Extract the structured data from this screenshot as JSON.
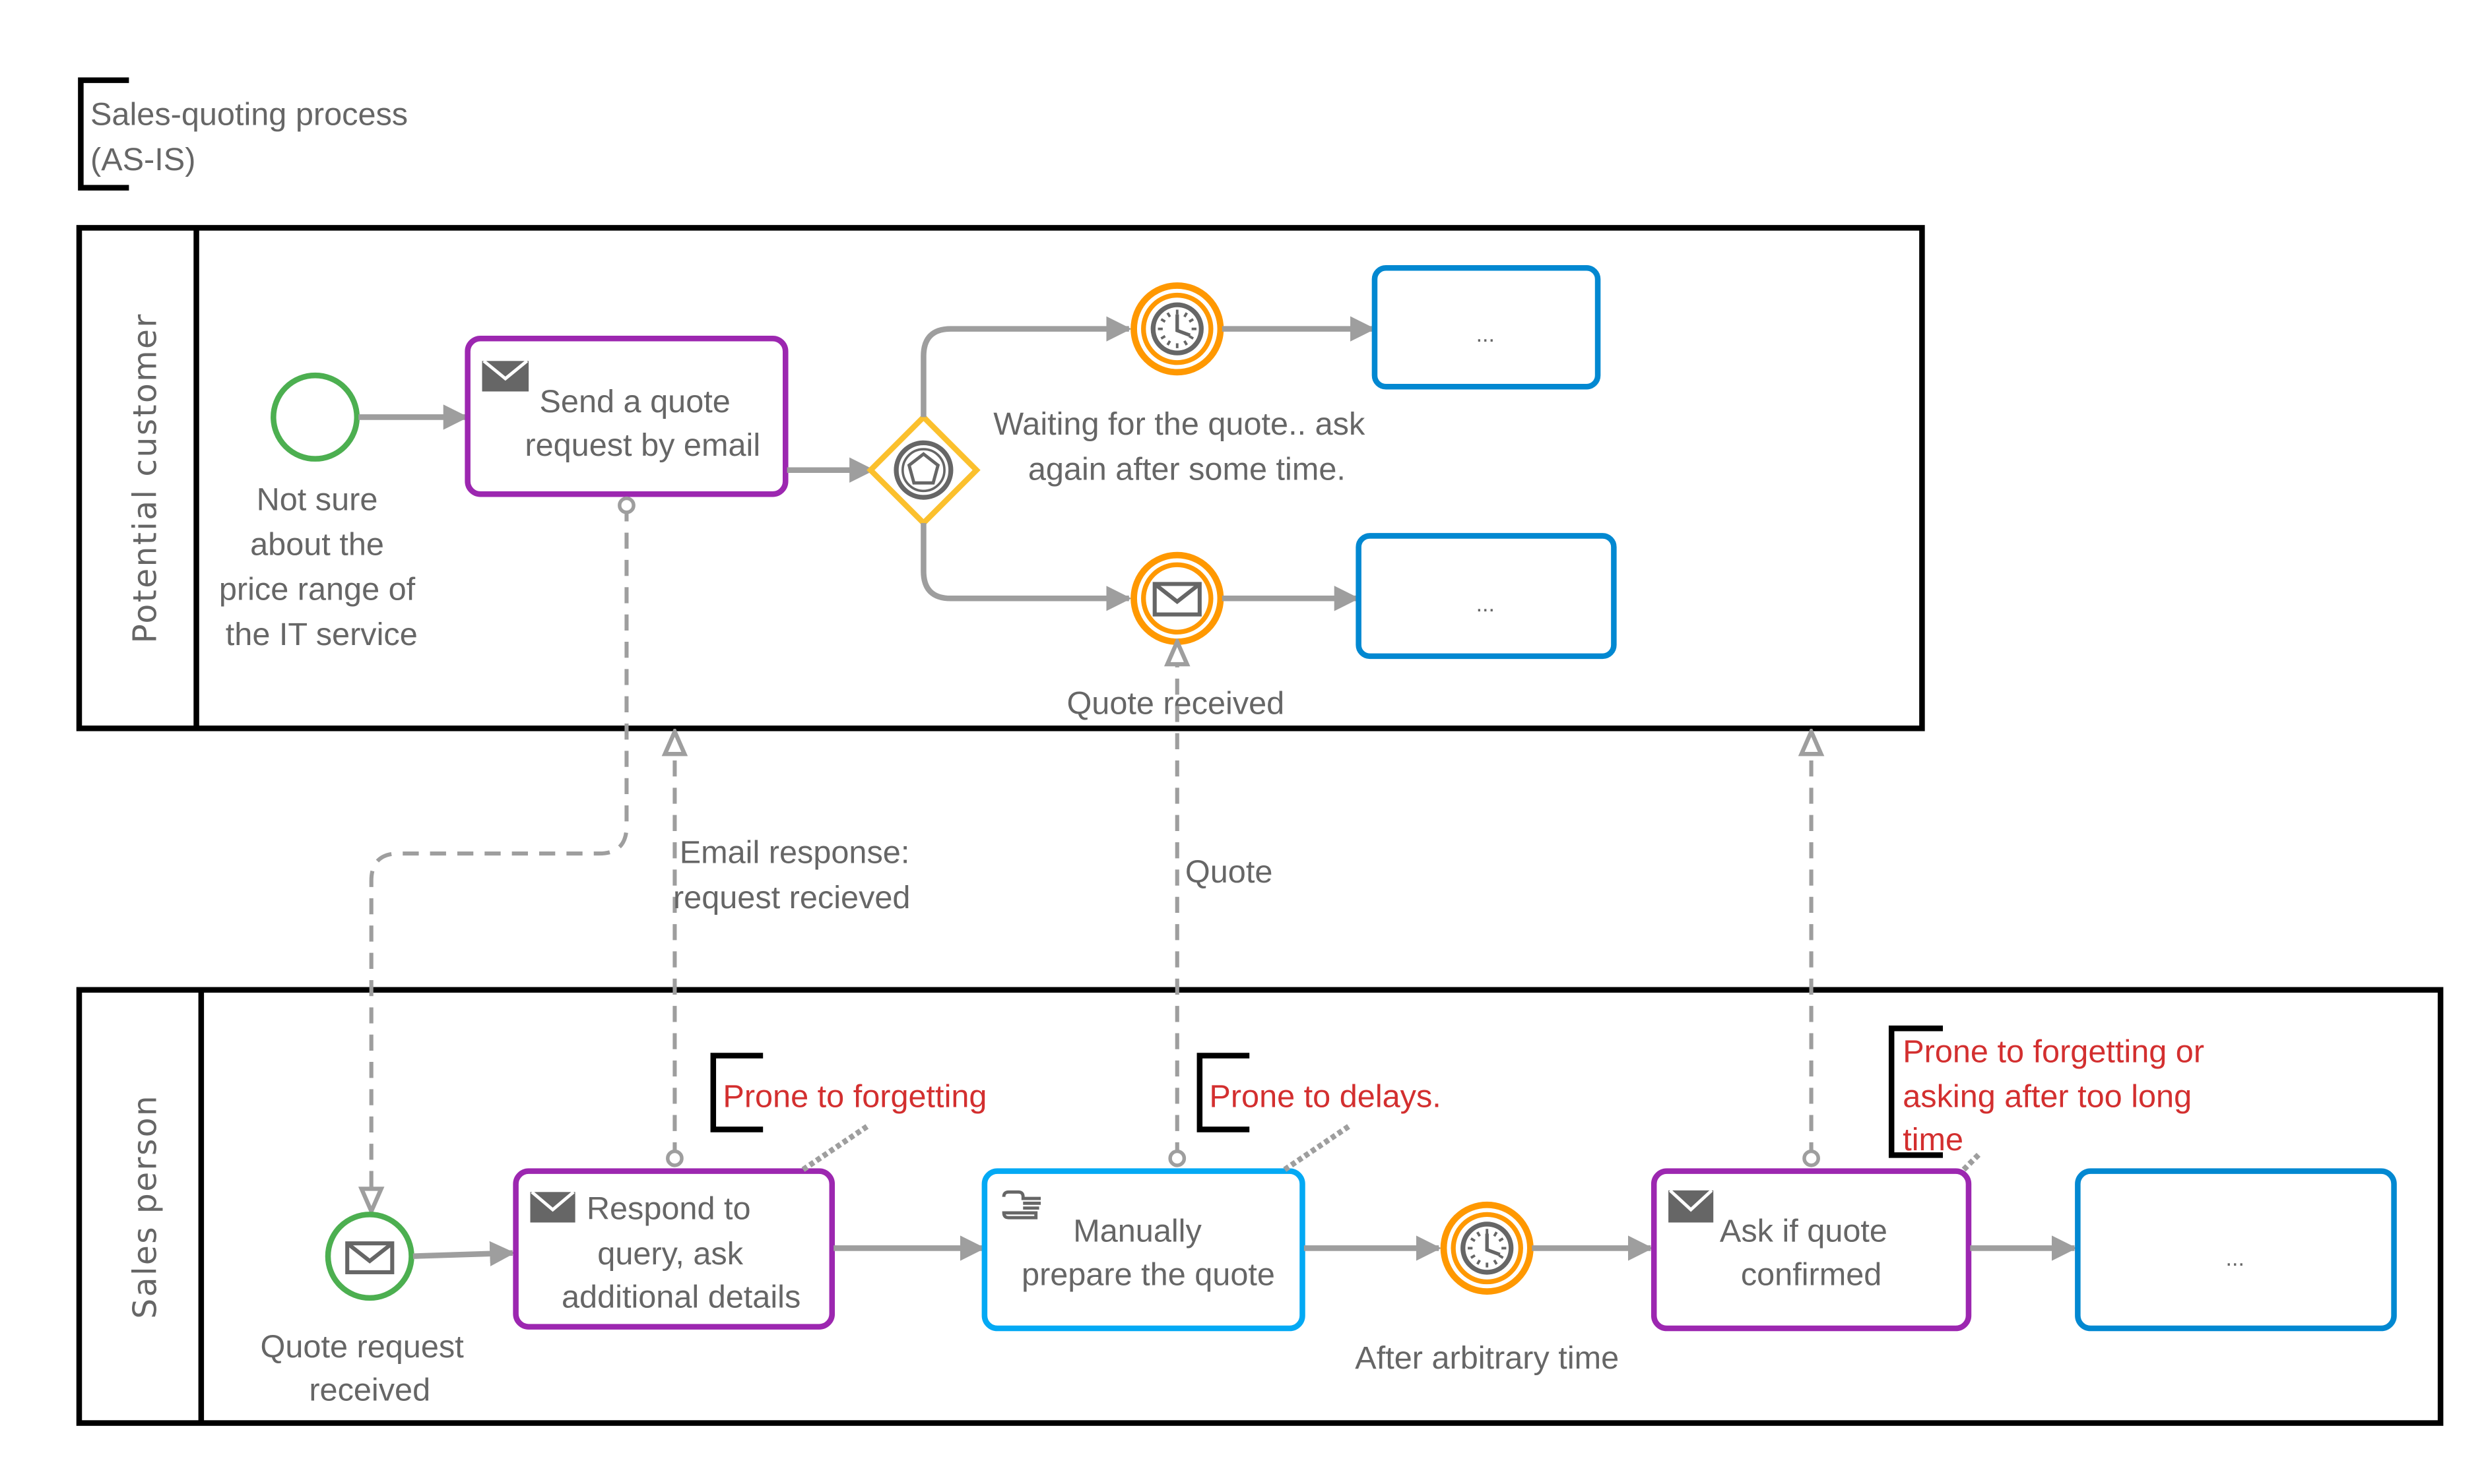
{
  "title": {
    "line1": "Sales-quoting process",
    "line2": "(AS-IS)"
  },
  "colors": {
    "pool_border": "#000000",
    "user_task": "#9C27B0",
    "generic_task": "#0288D1",
    "manual_task": "#03A9F4",
    "start_event": "#4CAF50",
    "intermediate_event": "#FF9800",
    "gateway": "#FBC02D",
    "flow": "#9E9E9E",
    "text": "#666666",
    "annotation_text": "#D32F2F"
  },
  "lanes": [
    {
      "label": "Potential customer"
    },
    {
      "label": "Sales person"
    }
  ],
  "customer": {
    "start_event": {
      "icon": "none",
      "label_lines": [
        "Not sure",
        "about the",
        "price range of",
        "the IT service"
      ]
    },
    "send_task": {
      "icon": "envelope-filled-icon",
      "label_lines": [
        "Send a quote",
        "request by email"
      ]
    },
    "gateway": {
      "type": "event-based",
      "icon": "pentagon-icon"
    },
    "timer_event": {
      "icon": "clock-icon"
    },
    "gateway_label_lines": [
      "Waiting for the quote.. ask",
      "again after some time."
    ],
    "message_event": {
      "icon": "envelope-icon",
      "label": "Quote received"
    },
    "task_top": {
      "label": "..."
    },
    "task_bottom": {
      "label": "..."
    }
  },
  "message_flows": [
    {
      "label": ""
    },
    {
      "label_lines": [
        "Email response:",
        "request recieved"
      ]
    },
    {
      "label": "Quote"
    },
    {
      "label": ""
    }
  ],
  "sales": {
    "start_event": {
      "icon": "envelope-icon",
      "label_lines": [
        "Quote request",
        "received"
      ]
    },
    "respond_task": {
      "icon": "envelope-filled-icon",
      "label_lines": [
        "Respond to",
        "query, ask",
        "additional details"
      ]
    },
    "manual_task": {
      "icon": "hand-icon",
      "label_lines": [
        "Manually",
        "prepare the quote"
      ]
    },
    "timer_event": {
      "icon": "clock-icon",
      "label": "After arbitrary time"
    },
    "ask_task": {
      "icon": "envelope-filled-icon",
      "label_lines": [
        "Ask if quote",
        "confirmed"
      ]
    },
    "end_task": {
      "label": "..."
    }
  },
  "annotations": [
    {
      "lines": [
        "Prone to forgetting"
      ]
    },
    {
      "lines": [
        "Prone to delays."
      ]
    },
    {
      "lines": [
        "Prone to forgetting or",
        "asking after too long",
        "time"
      ]
    }
  ]
}
